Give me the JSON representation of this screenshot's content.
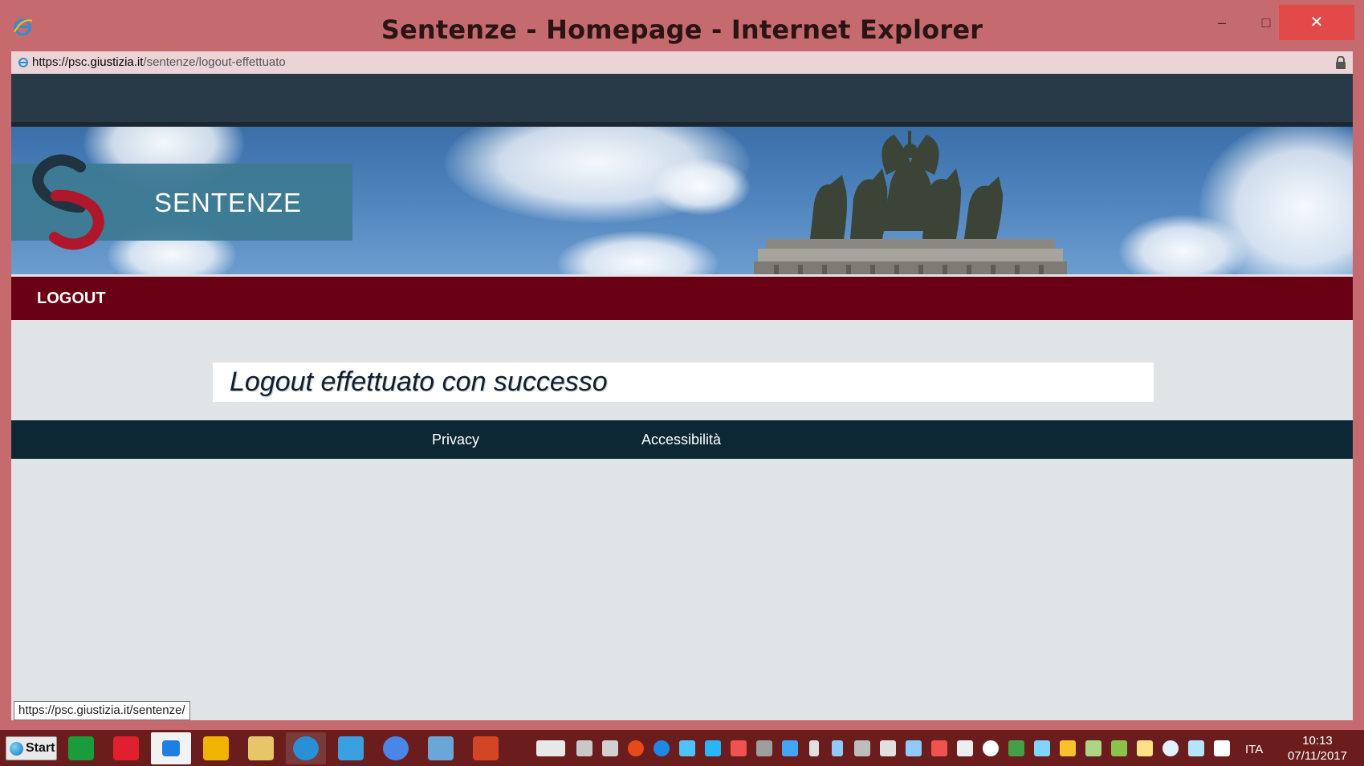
{
  "window": {
    "title": "Sentenze - Homepage - Internet Explorer",
    "minimize_label": "–",
    "maximize_label": "□",
    "close_label": "✕"
  },
  "address": {
    "url_prefix": "https://psc.",
    "url_domain": "giustizia.it",
    "url_path": "/sentenze/logout-effettuato"
  },
  "banner": {
    "brand": "SENTENZE"
  },
  "nav": {
    "logout": "LOGOUT"
  },
  "main": {
    "message": "Logout effettuato con successo"
  },
  "footer": {
    "privacy": "Privacy",
    "accessibility": "Accessibilità"
  },
  "statusbar": {
    "hover_url": "https://psc.giustizia.it/sentenze/"
  },
  "taskbar": {
    "start": "Start",
    "language": "ITA",
    "time": "10:13",
    "date": "07/11/2017"
  },
  "colors": {
    "window_frame": "#c56a6e",
    "nav_bar": "#6a0014",
    "footer": "#0d2835",
    "top_bar": "#283a47",
    "close_button": "#e24a4a"
  }
}
